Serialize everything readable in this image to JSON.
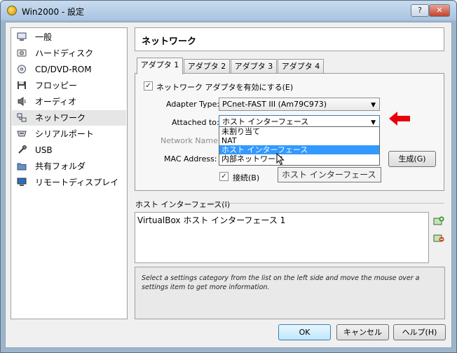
{
  "window": {
    "title": "Win2000 - 設定",
    "help_label": "?",
    "close_label": "✕"
  },
  "sidebar": {
    "items": [
      {
        "label": "一般",
        "icon": "general-icon"
      },
      {
        "label": "ハードディスク",
        "icon": "hard-disk-icon"
      },
      {
        "label": "CD/DVD-ROM",
        "icon": "cd-dvd-icon"
      },
      {
        "label": "フロッピー",
        "icon": "floppy-icon"
      },
      {
        "label": "オーディオ",
        "icon": "audio-icon"
      },
      {
        "label": "ネットワーク",
        "icon": "network-icon",
        "selected": true
      },
      {
        "label": "シリアルポート",
        "icon": "serial-port-icon"
      },
      {
        "label": "USB",
        "icon": "usb-icon"
      },
      {
        "label": "共有フォルダ",
        "icon": "shared-folder-icon"
      },
      {
        "label": "リモートディスプレイ",
        "icon": "remote-display-icon"
      }
    ]
  },
  "page": {
    "title": "ネットワーク"
  },
  "tabs": [
    "アダプタ 1",
    "アダプタ 2",
    "アダプタ 3",
    "アダプタ 4"
  ],
  "adapter": {
    "enable_label": "ネットワーク アダプタを有効にする(E)",
    "enable_checked": "✓",
    "adapter_type_label": "Adapter Type:",
    "adapter_type_value": "PCnet-FAST III (Am79C973)",
    "attached_to_label": "Attached to:",
    "attached_to_value": "ホスト インターフェース",
    "network_name_label": "Network Name:",
    "mac_address_label": "MAC Address:",
    "generate_button": "生成(G)",
    "connected_label": "接続(B)",
    "connected_checked": "✓",
    "dropdown_options": [
      "未割り当て",
      "NAT",
      "ホスト インターフェース",
      "内部ネットワーク"
    ],
    "tooltip": "ホスト インターフェース"
  },
  "host_interface": {
    "section_label": "ホスト インターフェース(I)",
    "items": [
      "VirtualBox ホスト インターフェース 1"
    ]
  },
  "info_text": "Select a settings category from the list on the left side and move the mouse over a settings item to get more information.",
  "buttons": {
    "ok": "OK",
    "cancel": "キャンセル",
    "help": "ヘルプ(H)"
  },
  "colors": {
    "highlight": "#3399ff",
    "annotation_arrow": "#e8000d"
  }
}
